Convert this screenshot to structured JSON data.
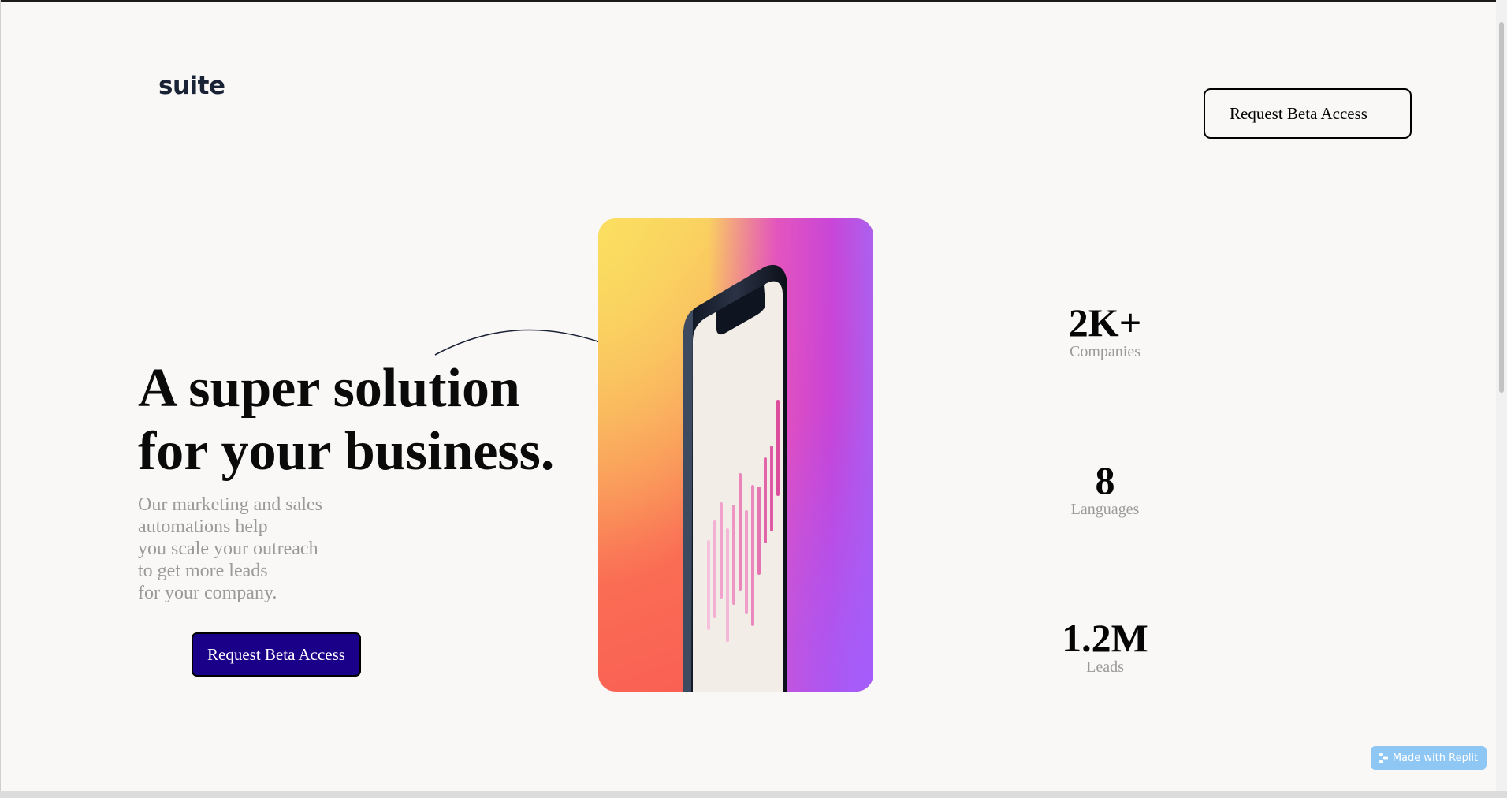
{
  "header": {
    "logo": "suite",
    "cta_label": "Request Beta Access"
  },
  "hero": {
    "title_lines": [
      "A super solution",
      "for your business."
    ],
    "description_lines": [
      "Our marketing and sales",
      "automations help",
      "you scale your outreach",
      "to get more leads",
      "for your company."
    ],
    "cta_label": "Request Beta Access"
  },
  "stats": [
    {
      "value": "2K+",
      "label": "Companies"
    },
    {
      "value": "8",
      "label": "Languages"
    },
    {
      "value": "1.2M",
      "label": "Leads"
    }
  ],
  "badge": {
    "label": "Made with Replit",
    "icon": "replit-icon"
  },
  "colors": {
    "accent_button": "#1a0088",
    "text_muted": "#9a9a9a",
    "logo": "#1a2236",
    "page_background": "#f9f8f6",
    "badge": "#8ec6f4"
  }
}
